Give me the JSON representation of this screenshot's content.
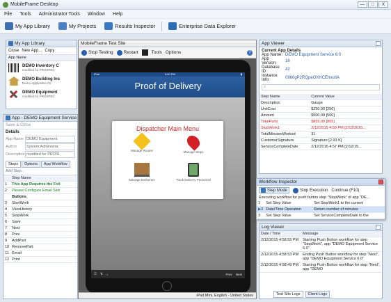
{
  "window": {
    "title": "MobileFrame Desktop",
    "min": "—",
    "max": "□",
    "close": "X"
  },
  "menu": [
    "File",
    "Tools",
    "Administrator Tools",
    "Window",
    "Help"
  ],
  "toolbar": {
    "library": "My App Library",
    "projects": "My Projects",
    "results": "Results Inspector",
    "explorer": "Enterprise Data Explorer"
  },
  "library": {
    "title": "My App Library",
    "actions": [
      "Close",
      "New App...",
      "Copy"
    ],
    "col": "App Name",
    "items": [
      {
        "name": "DEMO Inventory C",
        "sub": "modified for PROSPEC"
      },
      {
        "name": "DEMO Building Ins",
        "sub": "Demo Application for"
      },
      {
        "name": "DEMO Equipment",
        "sub": "modified for PROSPEC"
      }
    ]
  },
  "appwin": {
    "title": "App - DEMO Equipment Service",
    "save": "Save & Close",
    "details": "Details",
    "fields": [
      {
        "label": "App Name",
        "value": "DEMO Equipment"
      },
      {
        "label": "Author",
        "value": "System Administra"
      },
      {
        "label": "Description",
        "value": "modified for PROSI"
      }
    ],
    "tabs": [
      "Steps",
      "Options",
      "App Workflow"
    ],
    "addstep": "Add Step...",
    "col": "Step Name",
    "steps": [
      {
        "n": "1",
        "t": "This App Requires the Foll",
        "c": "green"
      },
      {
        "n": "2",
        "t": "Please Configure Email Sett",
        "c": "green"
      },
      {
        "n": "",
        "t": "Buttons",
        "c": "bold"
      },
      {
        "n": "3",
        "t": "StartWork"
      },
      {
        "n": "4",
        "t": "ViewHistory"
      },
      {
        "n": "5",
        "t": "StopWork"
      },
      {
        "n": "6",
        "t": "Save"
      },
      {
        "n": "7",
        "t": "Next"
      },
      {
        "n": "8",
        "t": "Prev"
      },
      {
        "n": "9",
        "t": "AddPart"
      },
      {
        "n": "10",
        "t": "RemovePart"
      },
      {
        "n": "11",
        "t": "Email"
      },
      {
        "n": "12",
        "t": "Print"
      }
    ]
  },
  "testsite": {
    "title": "MobileFrame Test Site",
    "stop": "Stop Testing",
    "restart": "Restart",
    "tools": "Tools",
    "options": "Options",
    "pod": "Proof of Delivery",
    "menu_title": "Dispatcher Main Menu",
    "tiles": [
      "Manage Routes",
      "Manage Stops",
      "Manage Deliveries",
      "Track Delivery Personnel"
    ],
    "prev": "Prev",
    "next": "Next",
    "status": "iPad Mini, English - United States",
    "ipad": "iPad",
    "time": "5:00 PM"
  },
  "appviewer": {
    "title": "App Viewer",
    "section": "Current App Details",
    "rows": [
      {
        "k": "App Name:",
        "v": "DEMO Equipment Service 6.0"
      },
      {
        "k": "App Version:",
        "v": "16"
      },
      {
        "k": "Database ID:",
        "v": "42"
      },
      {
        "k": "Instance Info:",
        "v": "0980gP2RQpeOXHCEhvuItA"
      }
    ],
    "cols": [
      "Step Name",
      "Current Value"
    ],
    "values": [
      {
        "k": "Description",
        "v": "Gauge"
      },
      {
        "k": "UnitCost",
        "v": "$250.00 [250]"
      },
      {
        "k": "Amount",
        "v": "$500.00 [500]"
      },
      {
        "k": "TotalParts",
        "v": "$865.00 [865]"
      },
      {
        "k": "StopWork1",
        "v": "2/12/2015 4:59 PM [2/12/2015..."
      },
      {
        "k": "TotalMinutesWorked",
        "v": "31"
      },
      {
        "k": "CustomerSignature",
        "v": "Signature  [2.93 K]"
      },
      {
        "k": "ServiceCompleteDate",
        "v": "2/12/2015 4:57 PM [2/12/15..."
      }
    ]
  },
  "workflow": {
    "title": "Workflow Inspector",
    "step": "Step Mode",
    "stop": "Stop Execution",
    "cont": "Continue (F10)",
    "exec": "Executing workflow for push button step \"StopWork\" of app \"DE...",
    "rows": [
      {
        "n": "1",
        "a": "Set Step Value",
        "d": "Set StopWork1 to the current"
      },
      {
        "n": "2",
        "a": "Date/Time Operation",
        "d": "Return number of minutes"
      },
      {
        "n": "3",
        "a": "Set Step Value",
        "d": "Set ServiceCompleteDate to the"
      }
    ]
  },
  "log": {
    "title": "Log Viewer",
    "cols": [
      "Date / Time",
      "Message"
    ],
    "rows": [
      {
        "t": "2/12/2015 4:58:55 PM",
        "m": "Starting Push Button workflow for step \"StopWork\", app \"DEMO Equipment Service 6.0\""
      },
      {
        "t": "2/12/2015 4:58:53 PM",
        "m": "Ending Push Button workflow for step \"Next\", app \"DEMO Equipment Service 6.0\""
      },
      {
        "t": "2/12/2015 4:58:49 PM",
        "m": "Starting Push Button workflow for step \"Next\", app \"DEMO"
      }
    ],
    "tabs": [
      "Test Site Logs",
      "Client Logs"
    ]
  }
}
